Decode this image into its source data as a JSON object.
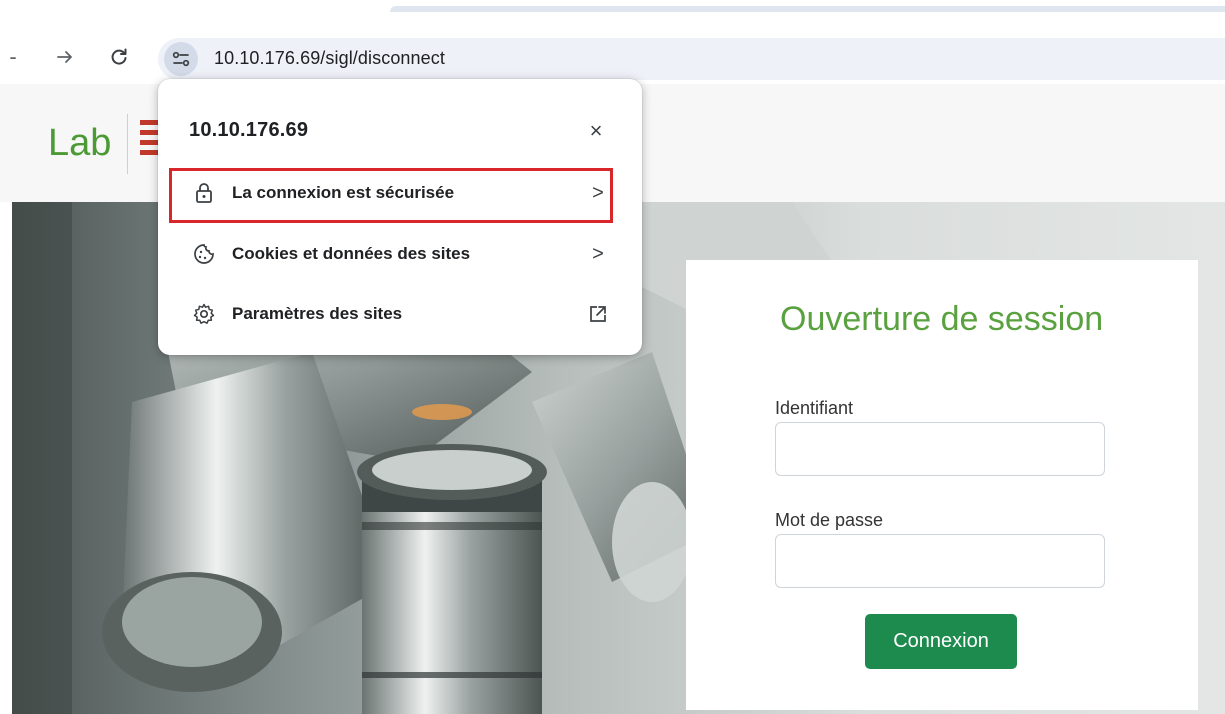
{
  "browser": {
    "url": "10.10.176.69/sigl/disconnect",
    "back_label": "-",
    "forward_icon": "arrow-right-icon",
    "reload_icon": "reload-icon",
    "site_info_icon": "tune-icon"
  },
  "site_info_popup": {
    "host": "10.10.176.69",
    "close_label": "×",
    "items": [
      {
        "label": "La connexion est sécurisée",
        "icon": "lock-icon",
        "trail": ">"
      },
      {
        "label": "Cookies et données des sites",
        "icon": "cookie-icon",
        "trail": ">"
      },
      {
        "label": "Paramètres des sites",
        "icon": "gear-icon",
        "trail": "external-link-icon"
      }
    ],
    "highlight_color": "#d8262b"
  },
  "page": {
    "logo_text": "Lab",
    "login": {
      "title": "Ouverture de session",
      "username_label": "Identifiant",
      "username_value": "",
      "password_label": "Mot de passe",
      "password_value": "",
      "submit_label": "Connexion"
    }
  },
  "colors": {
    "brand_green": "#5aa13f",
    "button_green": "#1d8a4e",
    "omnibox_bg": "#eef1f8"
  }
}
